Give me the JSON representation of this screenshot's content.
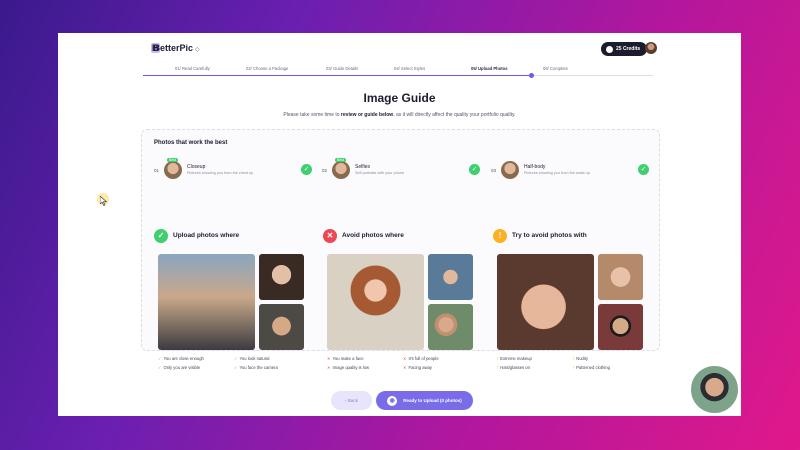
{
  "app": {
    "logo_text": "BetterPic",
    "credits": "25 Credits"
  },
  "steps": [
    {
      "label": "01/ Read Carefully",
      "active": false
    },
    {
      "label": "02/ Choose a Package",
      "active": false
    },
    {
      "label": "03/ Guide Details",
      "active": false
    },
    {
      "label": "04/ Select Styles",
      "active": false
    },
    {
      "label": "05/ Upload Photos",
      "active": true
    },
    {
      "label": "06/ Complete",
      "active": false
    }
  ],
  "page": {
    "title": "Image Guide",
    "subtitle_pre": "Please take some time to ",
    "subtitle_bold": "review or guide below",
    "subtitle_post": ", as it will directly affect the quality your portfolio quality."
  },
  "works": {
    "title": "Photos that work the best",
    "types": [
      {
        "num": "01",
        "name": "Closeup",
        "desc": "Pictures showing you from the chest up",
        "tag": "Best"
      },
      {
        "num": "02",
        "name": "Selfies",
        "desc": "Self portraits with your phone",
        "tag": "Best"
      },
      {
        "num": "03",
        "name": "Half-body",
        "desc": "Pictures showing you from the waist up",
        "tag": ""
      }
    ]
  },
  "columns": [
    {
      "icon": "check-icon",
      "glyph": "✓",
      "color": "#3ecf6e",
      "heading": "Upload photos where",
      "mark": "✓",
      "criteria": [
        "You are close enough",
        "You look natural",
        "Only you are visible",
        "You face the camera"
      ]
    },
    {
      "icon": "cross-icon",
      "glyph": "✕",
      "color": "#ef4655",
      "heading": "Avoid photos where",
      "mark": "✕",
      "criteria": [
        "You make a face",
        "It's full of people",
        "Image quality is low",
        "Facing away"
      ]
    },
    {
      "icon": "warning-icon",
      "glyph": "!",
      "color": "#ffb020",
      "heading": "Try to avoid photos with",
      "mark": "!",
      "criteria": [
        "Extreme makeup",
        "Nudity",
        "Hats/glasses on",
        "Patterned clothing"
      ]
    }
  ],
  "footer": {
    "back_label": "Back",
    "upload_label": "Ready to Upload (0 photos)"
  }
}
